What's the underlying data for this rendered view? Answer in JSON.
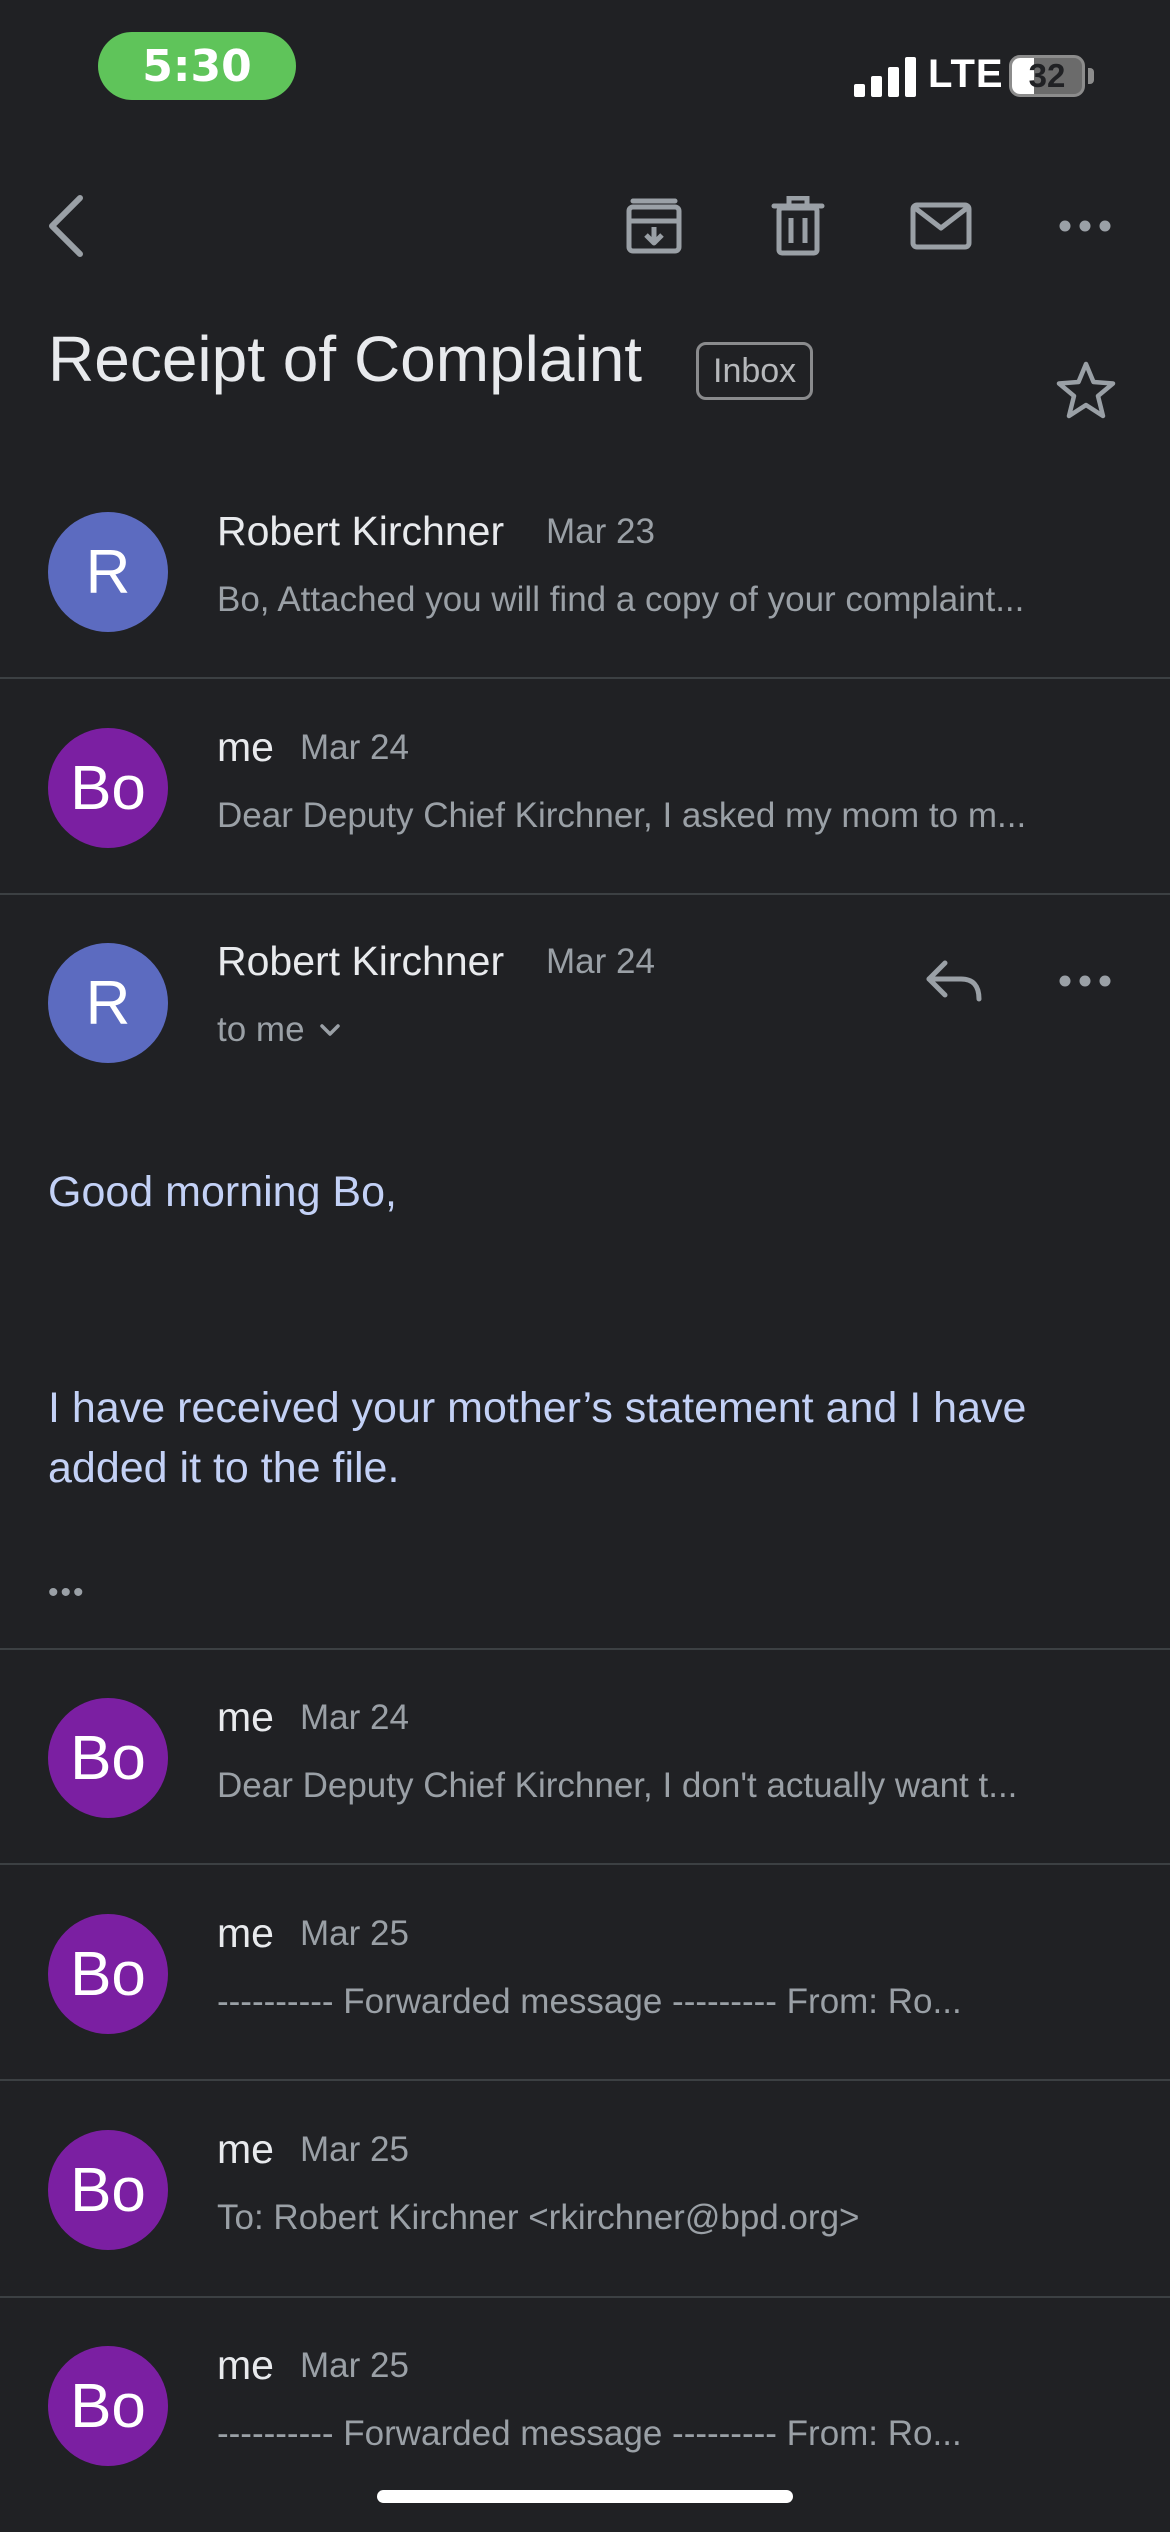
{
  "status_bar": {
    "time": "5:30",
    "network": "LTE",
    "battery_percent": 32,
    "battery_label": "32"
  },
  "toolbar": {
    "back_icon": "chevron-left-icon",
    "archive_icon": "archive-icon",
    "delete_icon": "trash-icon",
    "mark_unread_icon": "mail-icon",
    "more_icon": "more-horizontal-icon"
  },
  "thread": {
    "subject": "Receipt of Complaint",
    "label": "Inbox",
    "star_icon": "star-outline-icon"
  },
  "colors": {
    "background": "#202124",
    "avatar_r": "#5c6bc0",
    "avatar_bo": "#7b1fa2",
    "body_link": "#c3d1f6"
  },
  "messages": [
    {
      "avatar": "R",
      "sender": "Robert Kirchner",
      "date": "Mar 23",
      "snippet": "Bo, Attached you will find a copy of your complaint..."
    },
    {
      "avatar": "Bo",
      "sender": "me",
      "date": "Mar 24",
      "snippet": "Dear Deputy Chief Kirchner, I asked my mom to m..."
    }
  ],
  "expanded": {
    "avatar": "R",
    "sender": "Robert Kirchner",
    "date": "Mar 24",
    "recipient": "to me",
    "greeting": "Good morning Bo,",
    "body": "I have received your mother’s statement and I have added it to the file.",
    "reply_icon": "reply-icon",
    "more_icon": "more-horizontal-icon",
    "ellipsis": "•••"
  },
  "later_messages": [
    {
      "avatar": "Bo",
      "sender": "me",
      "date": "Mar 24",
      "snippet": "Dear Deputy Chief Kirchner, I don't actually want t..."
    },
    {
      "avatar": "Bo",
      "sender": "me",
      "date": "Mar 25",
      "snippet": "---------- Forwarded message --------- From: Ro..."
    },
    {
      "avatar": "Bo",
      "sender": "me",
      "date": "Mar 25",
      "snippet": "To: Robert Kirchner <rkirchner@bpd.org>"
    },
    {
      "avatar": "Bo",
      "sender": "me",
      "date": "Mar 25",
      "snippet": "---------- Forwarded message --------- From: Ro..."
    }
  ]
}
